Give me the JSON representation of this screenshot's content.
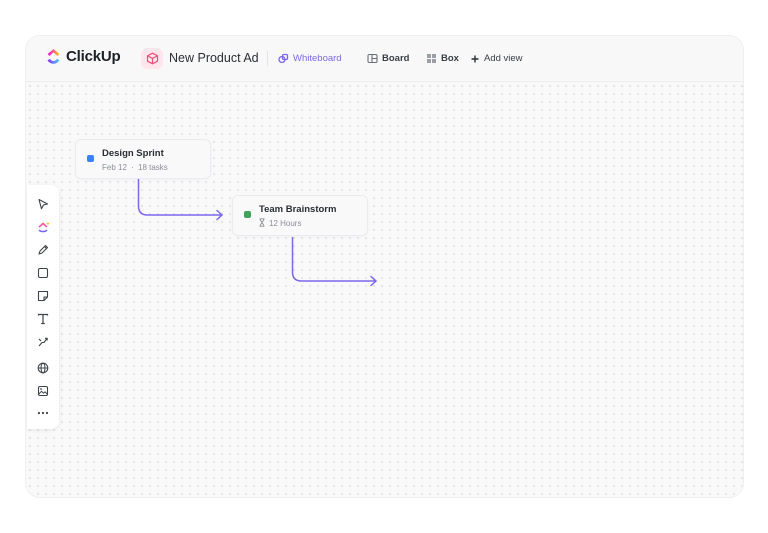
{
  "app": {
    "brand": "ClickUp"
  },
  "header": {
    "project_title": "New Product Ad",
    "views": [
      {
        "label": "Whiteboard",
        "icon": "whiteboard-icon",
        "active": true
      },
      {
        "label": "Board",
        "icon": "board-icon",
        "active": false
      },
      {
        "label": "Box",
        "icon": "box-icon",
        "active": false
      }
    ],
    "add_view": "Add view"
  },
  "colors": {
    "accent": "#7b68ee",
    "design_sprint": "#3b82f6",
    "team_brainstorm": "#40a35a"
  },
  "toolbar": {
    "tools": [
      "pointer-icon",
      "clickup-ai-icon",
      "pen-icon",
      "shape-square-icon",
      "sticky-note-icon",
      "text-icon",
      "connector-icon",
      "globe-icon",
      "image-icon",
      "more-icon"
    ]
  },
  "cards": [
    {
      "title": "Design Sprint",
      "date": "Feb 12",
      "separator": "·",
      "tasks": "18 tasks"
    },
    {
      "title": "Team Brainstorm",
      "duration": "12 Hours"
    }
  ]
}
